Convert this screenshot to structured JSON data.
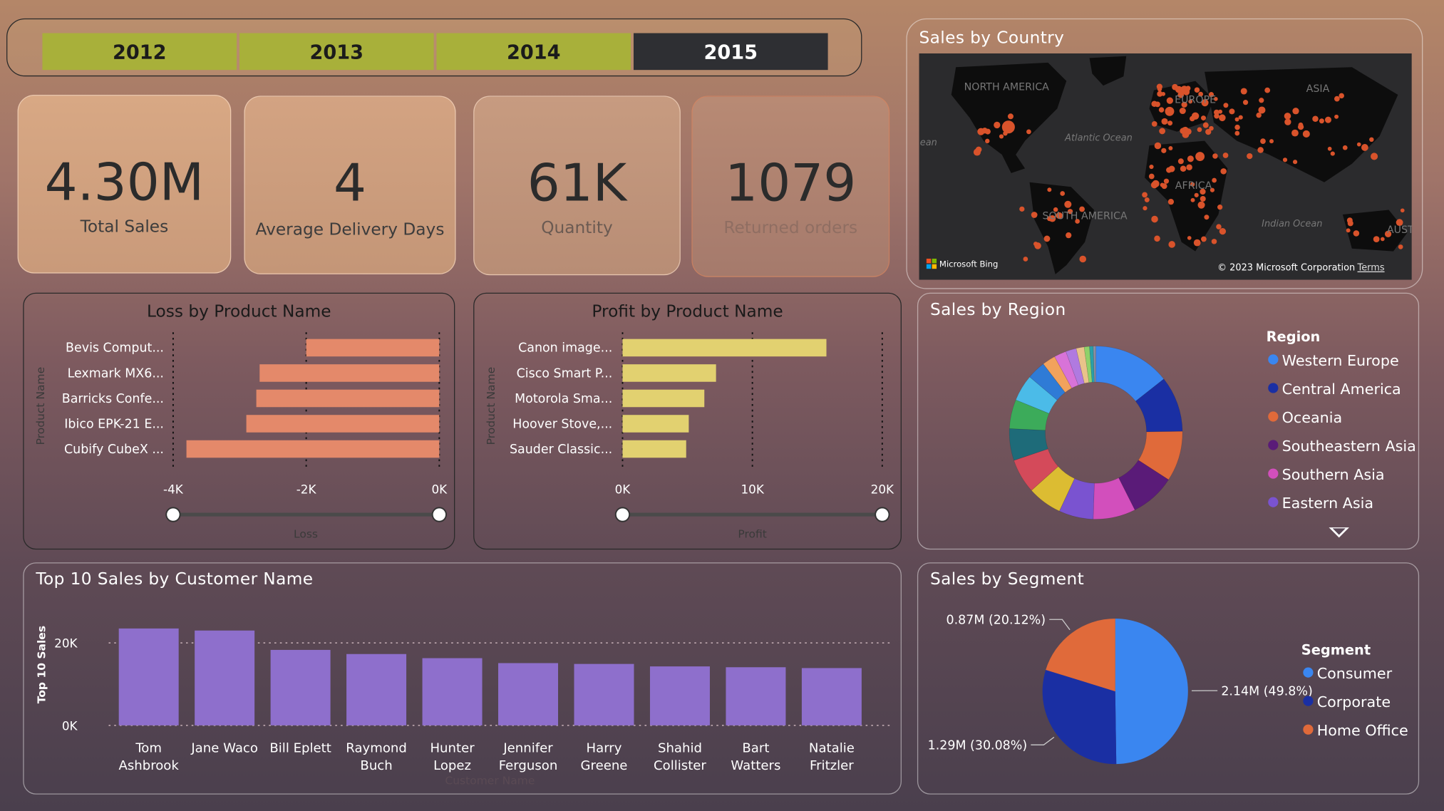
{
  "years": {
    "labels": [
      "2012",
      "2013",
      "2014",
      "2015"
    ],
    "selected": "2015",
    "active_color": "#a8b03a",
    "selected_color": "#2e2f33"
  },
  "kpis": [
    {
      "value": "4.30M",
      "label": "Total Sales"
    },
    {
      "value": "4",
      "label": "Average Delivery Days"
    },
    {
      "value": "61K",
      "label": "Quantity"
    },
    {
      "value": "1079",
      "label": "Returned orders"
    }
  ],
  "map": {
    "title": "Sales by Country",
    "labels": [
      "NORTH AMERICA",
      "Atlantic Ocean",
      "EUROPE",
      "ASIA",
      "AFRICA",
      "SOUTH AMERICA",
      "Indian Ocean",
      "AUSTRALI",
      "ean"
    ],
    "attribution_left": "Microsoft Bing",
    "attribution_right": "© 2023 Microsoft Corporation",
    "terms": "Terms"
  },
  "chart_data": [
    {
      "id": "loss",
      "type": "bar",
      "orientation": "horizontal",
      "title": "Loss by Product Name",
      "ylabel": "Product Name",
      "xlabel": "Loss",
      "categories": [
        "Bevis Comput...",
        "Lexmark MX6...",
        "Barricks Confe...",
        "Ibico EPK-21 E...",
        "Cubify CubeX ..."
      ],
      "values": [
        -2000,
        -2700,
        -2750,
        -2900,
        -3800
      ],
      "xlim": [
        -4000,
        0
      ],
      "ticks": [
        -4000,
        -2000,
        0
      ],
      "tick_labels": [
        "-4K",
        "-2K",
        "0K"
      ],
      "color": "#e4896a",
      "grid": true
    },
    {
      "id": "profit",
      "type": "bar",
      "orientation": "horizontal",
      "title": "Profit by Product Name",
      "ylabel": "Product Name",
      "xlabel": "Profit",
      "categories": [
        "Canon image...",
        "Cisco Smart P...",
        "Motorola Sma...",
        "Hoover Stove,...",
        "Sauder Classic..."
      ],
      "values": [
        15700,
        7200,
        6300,
        5100,
        4900
      ],
      "xlim": [
        0,
        20000
      ],
      "ticks": [
        0,
        10000,
        20000
      ],
      "tick_labels": [
        "0K",
        "10K",
        "20K"
      ],
      "color": "#e2d170",
      "grid": true
    },
    {
      "id": "customers",
      "type": "bar",
      "title": "Top 10 Sales by Customer Name",
      "ylabel": "Top 10 Sales",
      "xlabel": "Customer Name",
      "categories": [
        "Tom Ashbrook",
        "Jane Waco",
        "Bill Eplett",
        "Raymond Buch",
        "Hunter Lopez",
        "Jennifer Ferguson",
        "Harry Greene",
        "Shahid Collister",
        "Bart Watters",
        "Natalie Fritzler"
      ],
      "values": [
        23500,
        23000,
        18300,
        17300,
        16300,
        15100,
        14900,
        14300,
        14100,
        13900
      ],
      "ylim": [
        0,
        25000
      ],
      "ticks": [
        0,
        20000
      ],
      "tick_labels": [
        "0K",
        "20K"
      ],
      "color": "#8e6fcc",
      "grid": true
    },
    {
      "id": "region",
      "type": "pie",
      "donut": true,
      "title": "Sales by Region",
      "legend_title": "Region",
      "legend_position": "right",
      "legend": [
        "Western Europe",
        "Central America",
        "Oceania",
        "Southeastern Asia",
        "Southern Asia",
        "Eastern Asia"
      ],
      "slices": [
        {
          "name": "Western Europe",
          "value": 14.5,
          "color": "#3a86f0"
        },
        {
          "name": "Central America",
          "value": 10.5,
          "color": "#1a2fa3"
        },
        {
          "name": "Oceania",
          "value": 9.5,
          "color": "#e06a3a"
        },
        {
          "name": "Southeastern Asia",
          "value": 8.5,
          "color": "#5a1b78"
        },
        {
          "name": "Southern Asia",
          "value": 8,
          "color": "#d24fbc"
        },
        {
          "name": "Eastern Asia",
          "value": 6.5,
          "color": "#7a53d0"
        },
        {
          "name": "",
          "value": 6.5,
          "color": "#dcbc32"
        },
        {
          "name": "",
          "value": 6.5,
          "color": "#d44a5a"
        },
        {
          "name": "",
          "value": 6,
          "color": "#1e6b79"
        },
        {
          "name": "",
          "value": 5.5,
          "color": "#3cab5a"
        },
        {
          "name": "",
          "value": 5,
          "color": "#4bbbe8"
        },
        {
          "name": "",
          "value": 3.5,
          "color": "#2f7bd6"
        },
        {
          "name": "",
          "value": 2.5,
          "color": "#f2a25c"
        },
        {
          "name": "",
          "value": 2.3,
          "color": "#d873d8"
        },
        {
          "name": "",
          "value": 2,
          "color": "#b07ae0"
        },
        {
          "name": "",
          "value": 1.5,
          "color": "#e9c38a"
        },
        {
          "name": "",
          "value": 1,
          "color": "#8fd16a"
        },
        {
          "name": "",
          "value": 0.7,
          "color": "#2aa0a8"
        },
        {
          "name": "",
          "value": 0.5,
          "color": "#8a8fa0"
        }
      ]
    },
    {
      "id": "segment",
      "type": "pie",
      "title": "Sales by Segment",
      "legend_title": "Segment",
      "legend_position": "right",
      "slices": [
        {
          "name": "Consumer",
          "value": 2.14,
          "label": "2.14M (49.8%)",
          "color": "#3a86f0"
        },
        {
          "name": "Corporate",
          "value": 1.29,
          "label": "1.29M (30.08%)",
          "color": "#1a2fa3"
        },
        {
          "name": "Home Office",
          "value": 0.87,
          "label": "0.87M (20.12%)",
          "color": "#e06a3a"
        }
      ]
    }
  ]
}
